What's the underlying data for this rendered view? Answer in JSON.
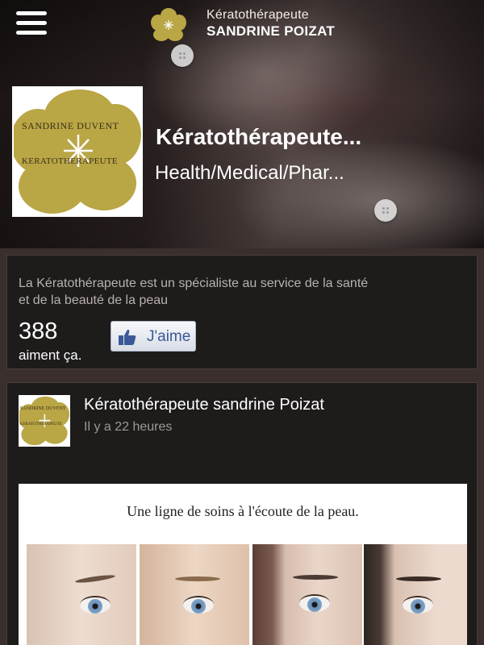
{
  "header": {
    "brand_title": "Kératothérapeute",
    "brand_name": "SANDRINE POIZAT",
    "logo_text_top": "SANDRINE DUVENT",
    "logo_text_bottom": "KERATOTHERAPEUTE"
  },
  "page": {
    "title": "Kératothérapeute...",
    "category": "Health/Medical/Phar..."
  },
  "about": {
    "description": "La Kératothérapeute est un spécialiste au service de la santé et de la beauté de la peau",
    "likes_count": "388",
    "likes_label": "aiment ça.",
    "like_button_label": "J'aime"
  },
  "post": {
    "author": "Kératothérapeute sandrine Poizat",
    "time": "Il y a 22 heures",
    "avatar_text_top": "SANDRINE DUVENT",
    "avatar_text_bottom": "KERATOTHERAPEUTE",
    "image_caption": "Une ligne de soins à l'écoute de la peau."
  },
  "colors": {
    "logo_gold": "#b9a645",
    "card_bg": "#1e1b1b",
    "facebook_blue": "#3b5998"
  },
  "icons": [
    "menu-icon",
    "flower-logo-icon",
    "more-options-icon",
    "thumbs-up-icon"
  ]
}
